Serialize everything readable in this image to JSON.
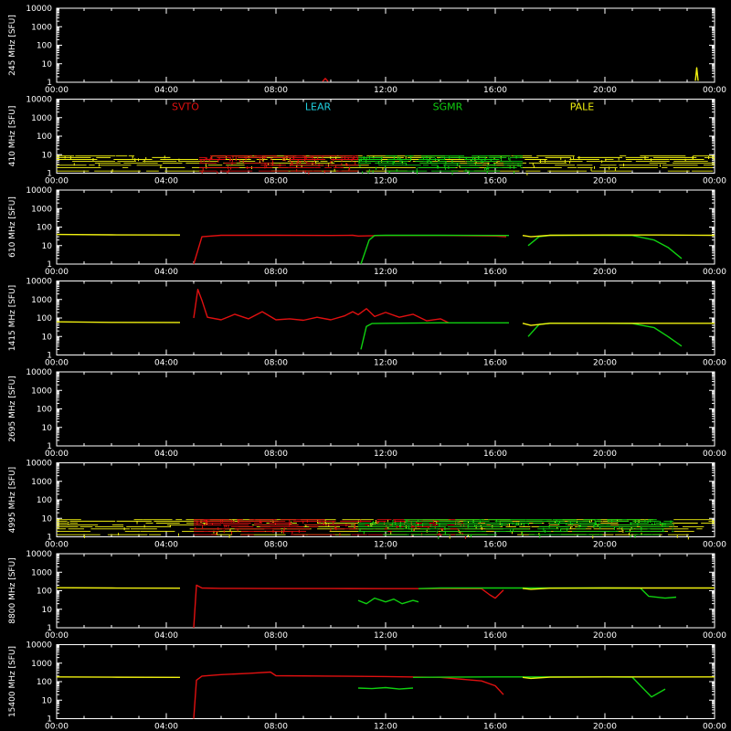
{
  "chart_data": {
    "type": "line",
    "time_range_hours": [
      0,
      24
    ],
    "x_ticks": [
      "00:00",
      "04:00",
      "08:00",
      "12:00",
      "16:00",
      "20:00",
      "00:00"
    ],
    "y_ticks": [
      "1",
      "10",
      "100",
      "1000",
      "10000"
    ],
    "y_scale": "log",
    "ylim": [
      1,
      10000
    ],
    "legend": [
      {
        "name": "SVTO",
        "color": "#e01010"
      },
      {
        "name": "LEAR",
        "color": "#20d0e0"
      },
      {
        "name": "SGMR",
        "color": "#10d010"
      },
      {
        "name": "PALE",
        "color": "#f0f010"
      }
    ],
    "panels": [
      {
        "ylabel": "245 MHz [SFU]",
        "series": [
          {
            "station": "SVTO",
            "x": [
              9.7,
              9.8,
              9.9
            ],
            "y": [
              1.1,
              1.6,
              1.1
            ]
          },
          {
            "station": "PALE",
            "x": [
              23.3,
              23.35,
              23.4
            ],
            "y": [
              1.2,
              6,
              1.2
            ]
          }
        ]
      },
      {
        "ylabel": "410 MHz [SFU]",
        "noisy": true,
        "series": [
          {
            "station": "PALE",
            "x": [
              0,
              2,
              4.5,
              5,
              17,
              20,
              24
            ],
            "y": [
              5,
              6,
              5,
              1,
              5,
              5,
              5
            ]
          },
          {
            "station": "SVTO",
            "x": [
              5.2,
              7,
              9,
              11
            ],
            "y": [
              5,
              4,
              5,
              5
            ]
          },
          {
            "station": "SGMR",
            "x": [
              11,
              13,
              15,
              17
            ],
            "y": [
              5,
              5,
              5,
              5
            ]
          }
        ]
      },
      {
        "ylabel": "610 MHz [SFU]",
        "series": [
          {
            "station": "PALE",
            "x": [
              0,
              2,
              4.5
            ],
            "y": [
              40,
              38,
              37
            ]
          },
          {
            "station": "SVTO",
            "x": [
              5,
              5.3,
              6,
              8,
              10,
              10.8,
              11,
              12,
              14,
              16,
              16.4
            ],
            "y": [
              1,
              30,
              36,
              36,
              35,
              36,
              33,
              35,
              35,
              33,
              30
            ]
          },
          {
            "station": "SGMR",
            "x": [
              11.1,
              11.4,
              11.6,
              12,
              14,
              16.5
            ],
            "y": [
              1,
              20,
              35,
              36,
              36,
              35
            ]
          },
          {
            "station": "SGMR",
            "x": [
              17.2,
              17.6,
              18,
              20,
              21,
              21.8,
              22.3,
              22.8
            ],
            "y": [
              10,
              30,
              36,
              36,
              35,
              20,
              8,
              2
            ]
          },
          {
            "station": "PALE",
            "x": [
              17,
              17.3,
              18,
              20,
              22,
              24
            ],
            "y": [
              35,
              30,
              36,
              37,
              37,
              36
            ]
          }
        ]
      },
      {
        "ylabel": "1415 MHz [SFU]",
        "series": [
          {
            "station": "PALE",
            "x": [
              0,
              2,
              4.5
            ],
            "y": [
              62,
              58,
              57
            ]
          },
          {
            "station": "SVTO",
            "x": [
              5,
              5.15,
              5.3,
              5.5,
              6,
              6.5,
              7,
              7.5,
              8,
              8.5,
              9,
              9.5,
              10,
              10.5,
              10.8,
              11,
              11.3,
              11.6,
              12,
              12.5,
              13,
              13.5,
              14,
              14.3
            ],
            "y": [
              100,
              3500,
              900,
              110,
              80,
              160,
              90,
              220,
              80,
              90,
              75,
              110,
              80,
              130,
              220,
              150,
              320,
              120,
              200,
              110,
              160,
              70,
              90,
              55
            ]
          },
          {
            "station": "SGMR",
            "x": [
              11.1,
              11.3,
              11.5,
              12,
              14,
              16.5
            ],
            "y": [
              2,
              35,
              50,
              52,
              55,
              55
            ]
          },
          {
            "station": "SGMR",
            "x": [
              17.2,
              17.6,
              18,
              20,
              21,
              21.8,
              22.3,
              22.8
            ],
            "y": [
              10,
              45,
              52,
              52,
              50,
              30,
              10,
              3
            ]
          },
          {
            "station": "PALE",
            "x": [
              17,
              17.3,
              18,
              20,
              22,
              24
            ],
            "y": [
              52,
              40,
              52,
              52,
              52,
              52
            ]
          }
        ]
      },
      {
        "ylabel": "2695 MHz [SFU]",
        "series": []
      },
      {
        "ylabel": "4995 MHz [SFU]",
        "noisy": true,
        "series": [
          {
            "station": "PALE",
            "x": [
              0,
              2,
              4.5,
              17,
              20,
              24
            ],
            "y": [
              5,
              6,
              5,
              5,
              5,
              5
            ]
          },
          {
            "station": "SVTO",
            "x": [
              5,
              7,
              9,
              11,
              13,
              15
            ],
            "y": [
              5,
              4,
              5,
              5,
              4,
              5
            ]
          },
          {
            "station": "SGMR",
            "x": [
              11,
              13,
              15,
              17,
              20,
              22.5
            ],
            "y": [
              5,
              6,
              6,
              6,
              6,
              6
            ]
          }
        ]
      },
      {
        "ylabel": "8800 MHz [SFU]",
        "series": [
          {
            "station": "PALE",
            "x": [
              0,
              2,
              4.5
            ],
            "y": [
              145,
              140,
              138
            ]
          },
          {
            "station": "SVTO",
            "x": [
              5,
              5.1,
              5.3,
              6,
              8,
              10,
              12,
              14,
              15.5,
              15.8,
              16,
              16.3
            ],
            "y": [
              1,
              200,
              140,
              135,
              132,
              132,
              130,
              130,
              128,
              60,
              40,
              110
            ]
          },
          {
            "station": "SGMR",
            "x": [
              11,
              11.3,
              11.6,
              12,
              12.3,
              12.6,
              13,
              13.2
            ],
            "y": [
              30,
              20,
              40,
              25,
              35,
              20,
              30,
              25
            ]
          },
          {
            "station": "SGMR",
            "x": [
              13.2,
              14,
              16,
              17.2,
              18,
              20,
              21.3,
              21.6,
              22.2,
              22.6
            ],
            "y": [
              130,
              140,
              140,
              140,
              140,
              140,
              138,
              50,
              40,
              45
            ]
          },
          {
            "station": "PALE",
            "x": [
              17,
              17.3,
              18,
              20,
              22,
              24
            ],
            "y": [
              135,
              120,
              138,
              140,
              140,
              140
            ]
          }
        ]
      },
      {
        "ylabel": "15400 MHz [SFU]",
        "series": [
          {
            "station": "PALE",
            "x": [
              0,
              2,
              4.5
            ],
            "y": [
              180,
              175,
              170
            ]
          },
          {
            "station": "SVTO",
            "x": [
              5,
              5.1,
              5.3,
              6,
              7,
              7.8,
              8,
              10,
              12,
              14,
              15.5,
              16,
              16.3
            ],
            "y": [
              1,
              120,
              200,
              240,
              280,
              330,
              210,
              200,
              190,
              170,
              110,
              60,
              20
            ]
          },
          {
            "station": "SGMR",
            "x": [
              11,
              11.5,
              12,
              12.5,
              13
            ],
            "y": [
              45,
              42,
              48,
              40,
              45
            ]
          },
          {
            "station": "SGMR",
            "x": [
              13,
              14,
              16,
              17.2,
              18,
              20,
              21,
              21.3,
              21.7,
              22.2
            ],
            "y": [
              170,
              175,
              180,
              180,
              180,
              180,
              175,
              60,
              15,
              40
            ]
          },
          {
            "station": "PALE",
            "x": [
              17,
              17.3,
              18,
              20,
              22,
              24
            ],
            "y": [
              170,
              150,
              175,
              180,
              180,
              180
            ]
          }
        ]
      }
    ]
  }
}
